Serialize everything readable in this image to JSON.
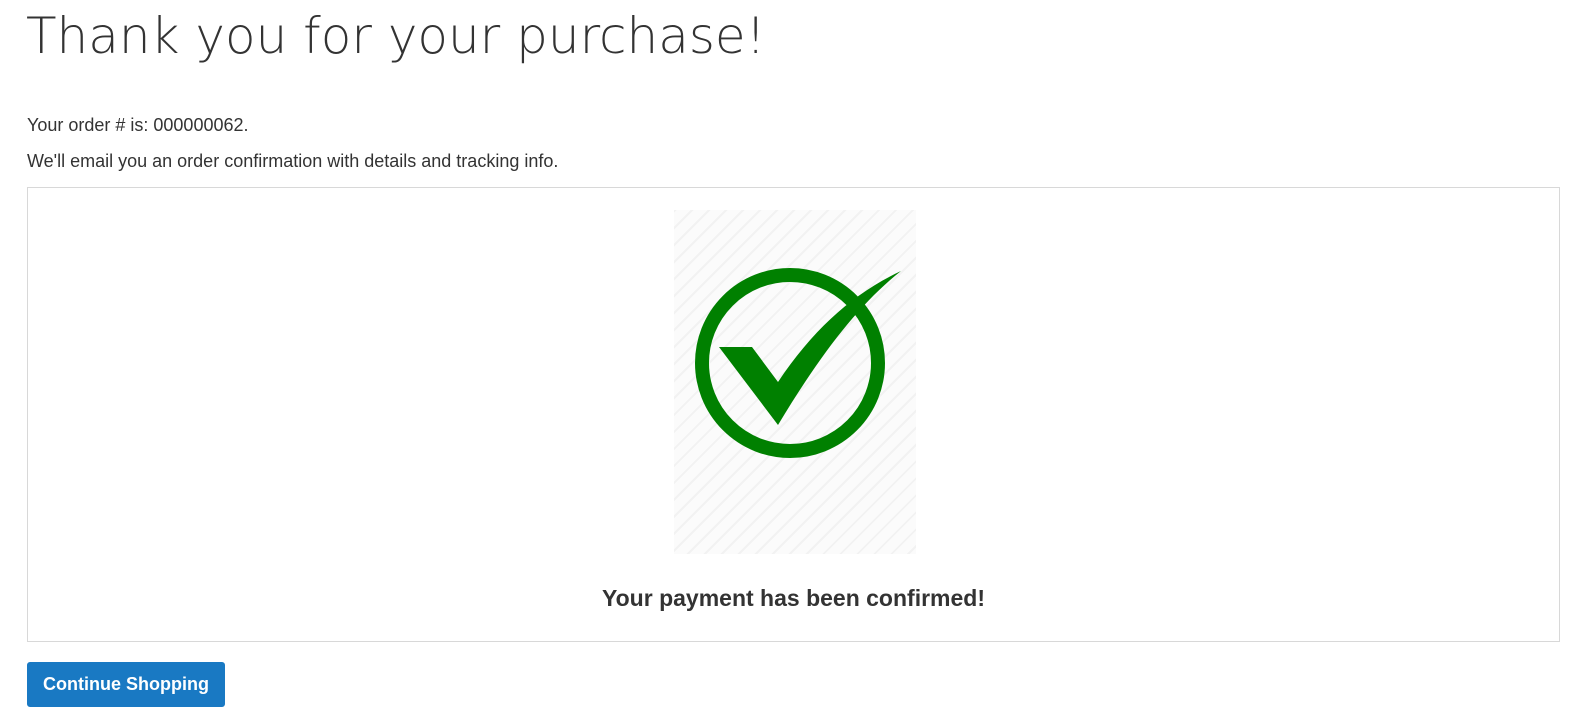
{
  "page": {
    "title": "Thank you for your purchase!",
    "order_line": "Your order # is: 000000062.",
    "email_line": "We'll email you an order confirmation with details and tracking info."
  },
  "confirmation": {
    "icon": "check-circle-icon",
    "icon_color": "#008000",
    "message": "Your payment has been confirmed!"
  },
  "actions": {
    "continue_label": "Continue Shopping",
    "button_color": "#1979c3"
  }
}
